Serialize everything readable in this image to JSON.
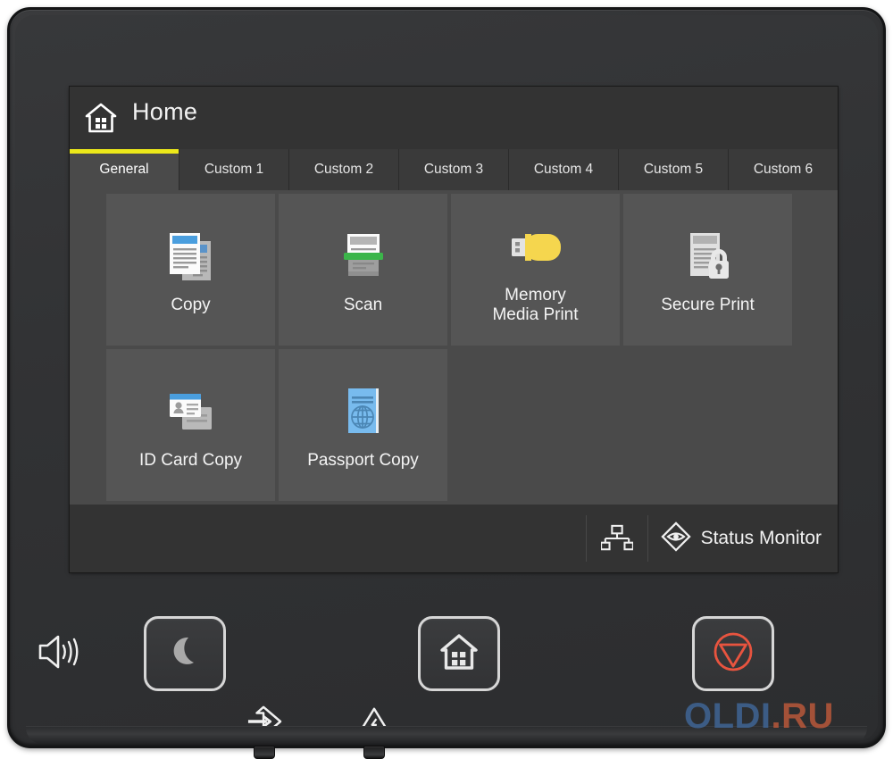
{
  "device": {
    "type": "printer-control-panel"
  },
  "screen": {
    "header": {
      "title": "Home",
      "home_icon": "home-house-icon",
      "accent_color": "#ece81a"
    },
    "tabs": [
      {
        "label": "General",
        "active": true
      },
      {
        "label": "Custom 1",
        "active": false
      },
      {
        "label": "Custom 2",
        "active": false
      },
      {
        "label": "Custom 3",
        "active": false
      },
      {
        "label": "Custom 4",
        "active": false
      },
      {
        "label": "Custom 5",
        "active": false
      },
      {
        "label": "Custom 6",
        "active": false
      }
    ],
    "tiles": [
      {
        "label": "Copy",
        "icon": "copy-documents-icon",
        "color": "#4a9ede"
      },
      {
        "label": "Scan",
        "icon": "scanner-icon",
        "color": "#34a853"
      },
      {
        "label": "Memory\nMedia Print",
        "icon": "usb-flash-drive-icon",
        "color": "#f2d34a"
      },
      {
        "label": "Secure Print",
        "icon": "document-lock-icon",
        "color": "#d9d9d9"
      },
      {
        "label": "ID Card Copy",
        "icon": "id-card-icon",
        "color": "#4a9ede"
      },
      {
        "label": "Passport Copy",
        "icon": "passport-globe-icon",
        "color": "#79b9ee"
      }
    ],
    "tile_labels": {
      "copy": "Copy",
      "scan": "Scan",
      "memory_media_print_line1": "Memory",
      "memory_media_print_line2": "Media Print",
      "secure_print": "Secure Print",
      "id_card_copy": "ID Card Copy",
      "passport_copy": "Passport Copy"
    },
    "status_bar": {
      "network_icon": "network-lan-icon",
      "status_monitor_icon": "eye-diamond-icon",
      "status_monitor_label": "Status Monitor"
    }
  },
  "hardware": {
    "speaker_icon": "speaker-volume-icon",
    "buttons": [
      {
        "name": "sleep",
        "icon": "crescent-moon-icon"
      },
      {
        "name": "home",
        "icon": "home-house-icon"
      },
      {
        "name": "stop",
        "icon": "stop-circle-triangle-icon",
        "color": "#e8543f"
      }
    ],
    "indicators": [
      {
        "name": "processing-data",
        "icon": "arrow-into-diamond-icon"
      },
      {
        "name": "error",
        "icon": "warning-triangle-icon"
      }
    ]
  },
  "watermark": {
    "part1": "OLDI",
    "dot": ".",
    "part2": "RU"
  }
}
